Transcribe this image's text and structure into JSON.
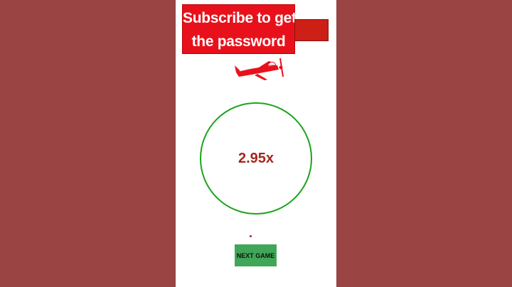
{
  "banner": {
    "line1": "Subscribe to get",
    "line2": "the password"
  },
  "game": {
    "multiplier": "2.95x",
    "next_button_label": "NEXT GAME",
    "plane_icon": "airplane-icon"
  },
  "colors": {
    "background": "#9b4444",
    "panel": "#ffffff",
    "banner": "#e8111b",
    "circle_border": "#1aa31a",
    "multiplier_text": "#a3271f",
    "button": "#3fa757"
  }
}
